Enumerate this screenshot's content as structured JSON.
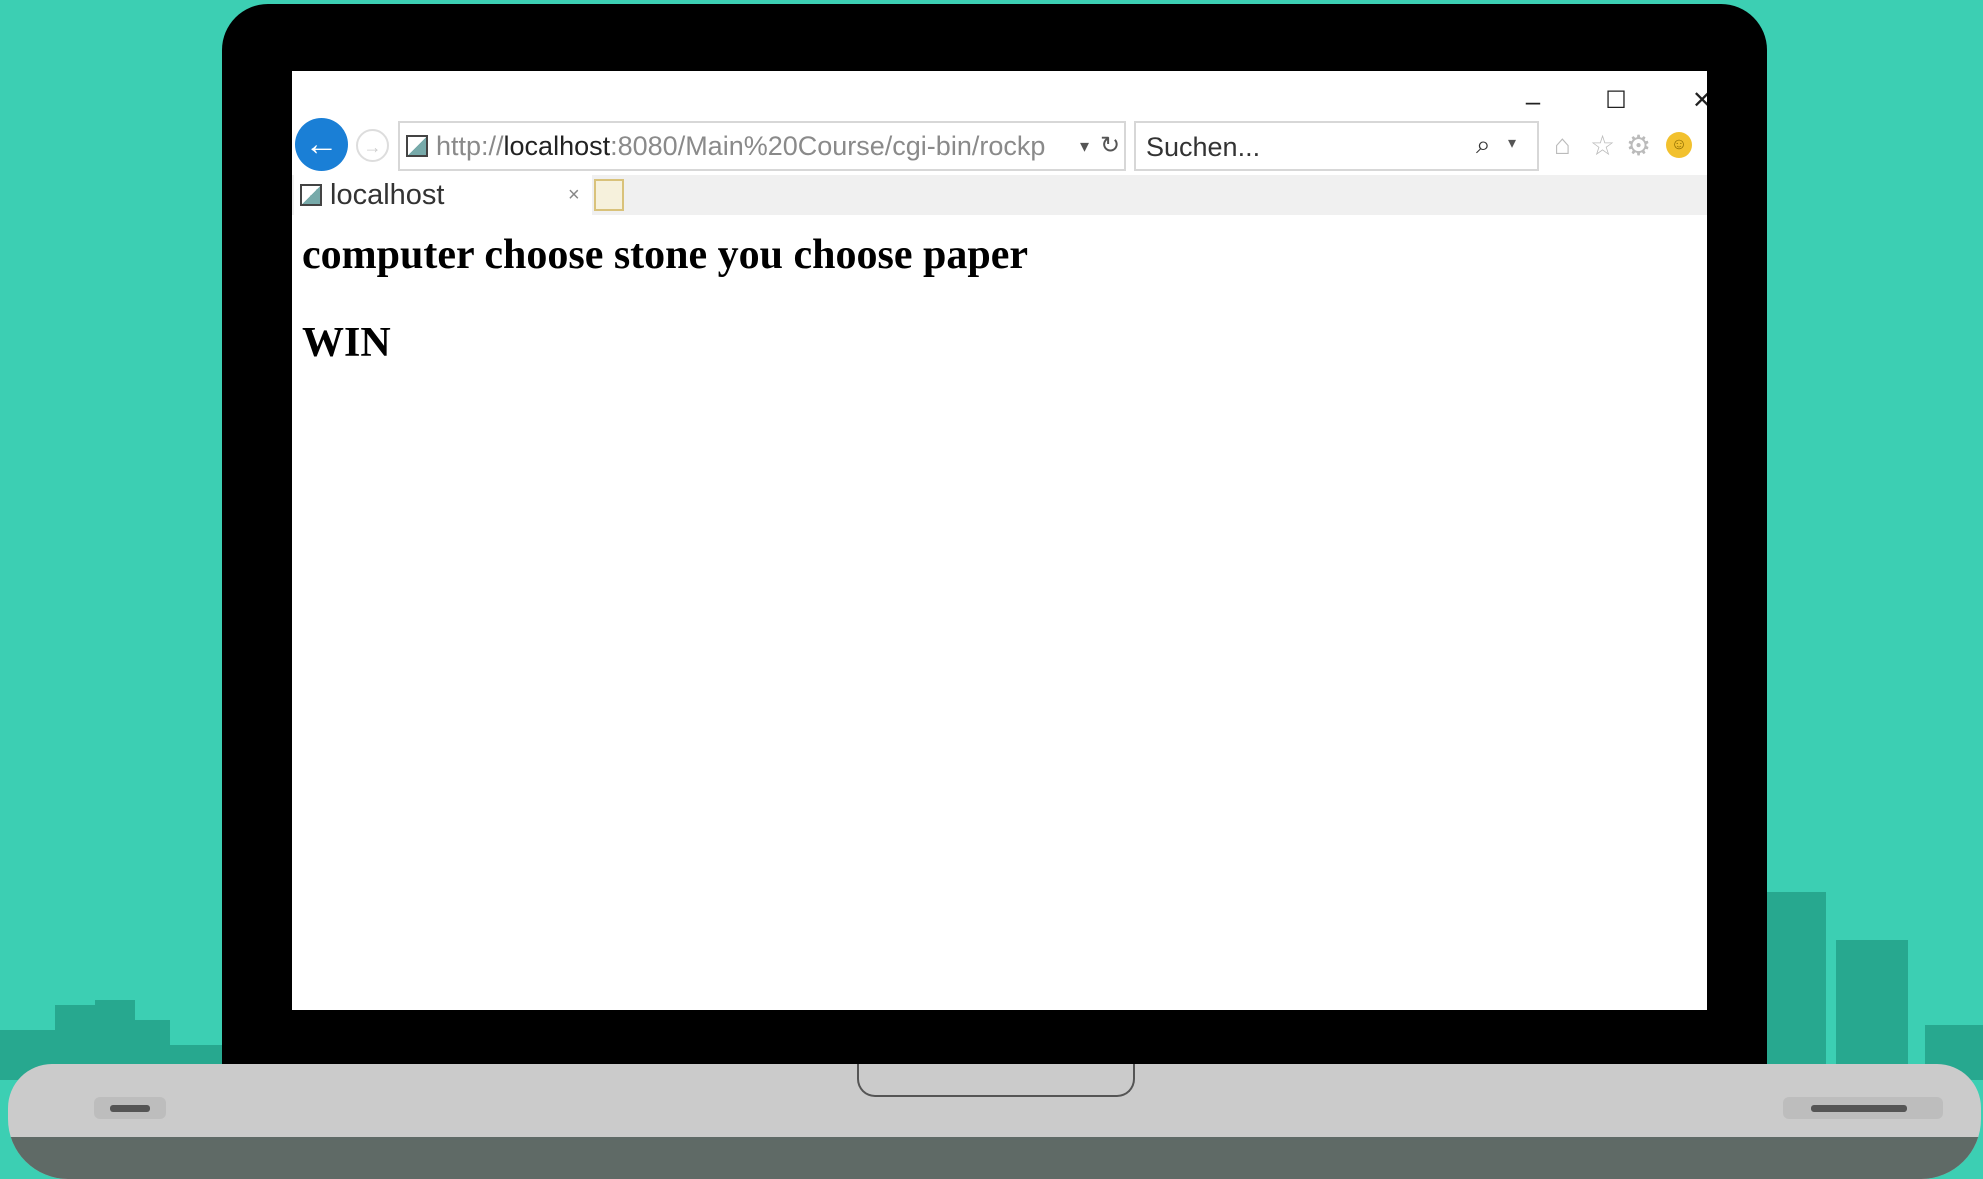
{
  "browser": {
    "window_controls": {
      "minimize": "–",
      "maximize": "☐",
      "close": "✕"
    },
    "nav": {
      "back_icon": "←",
      "forward_icon": "→"
    },
    "address_bar": {
      "scheme": "http://",
      "host": "localhost",
      "rest": ":8080/Main%20Course/cgi-bin/rockp",
      "dropdown": "▾",
      "refresh_icon": "↻"
    },
    "search": {
      "placeholder": "Suchen...",
      "magnifier_icon": "⌕",
      "dropdown": "▾"
    },
    "toolbar_icons": {
      "home": "⌂",
      "favorites": "☆",
      "settings": "⚙",
      "feedback": "☺"
    },
    "tab": {
      "title": "localhost",
      "close": "×"
    }
  },
  "page": {
    "message": "computer choose stone you choose paper",
    "result": "WIN"
  }
}
